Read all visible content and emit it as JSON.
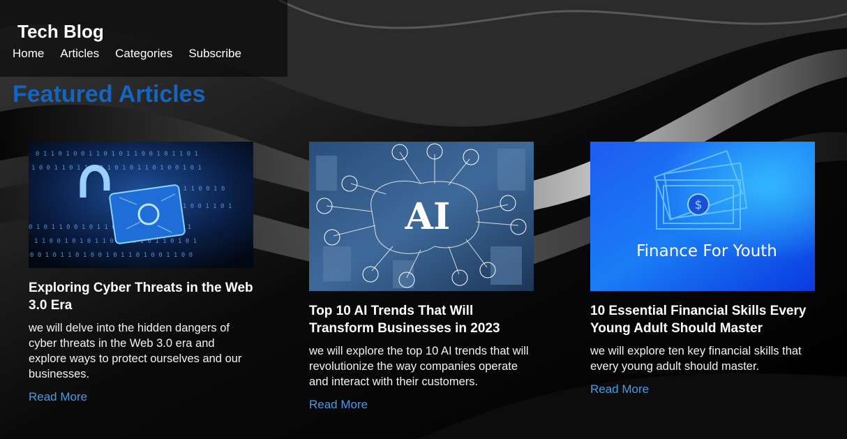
{
  "site": {
    "title": "Tech Blog"
  },
  "nav": {
    "items": [
      "Home",
      "Articles",
      "Categories",
      "Subscribe"
    ]
  },
  "featured": {
    "heading": "Featured Articles"
  },
  "articles": [
    {
      "title": "Exploring Cyber Threats in the Web 3.0 Era",
      "excerpt": "we will delve into the hidden dangers of cyber threats in the Web 3.0 era and explore ways to protect ourselves and our businesses.",
      "link": "Read More",
      "image_icon": "padlock-binary-image"
    },
    {
      "title": "Top 10 AI Trends That Will Transform Businesses in 2023",
      "excerpt": "we will explore the top 10 AI trends that will revolutionize the way companies operate and interact with their customers.",
      "link": "Read More",
      "image_label": "AI",
      "image_icon": "ai-network-image"
    },
    {
      "title": "10 Essential Financial Skills Every Young Adult Should Master",
      "excerpt": "we will explore ten key financial skills that every young adult should master.",
      "link": "Read More",
      "image_label": "Finance For Youth",
      "image_icon": "money-bill-image"
    }
  ],
  "colors": {
    "accent_heading": "#1565c0",
    "link": "#4a9be8",
    "background": "#050505"
  }
}
